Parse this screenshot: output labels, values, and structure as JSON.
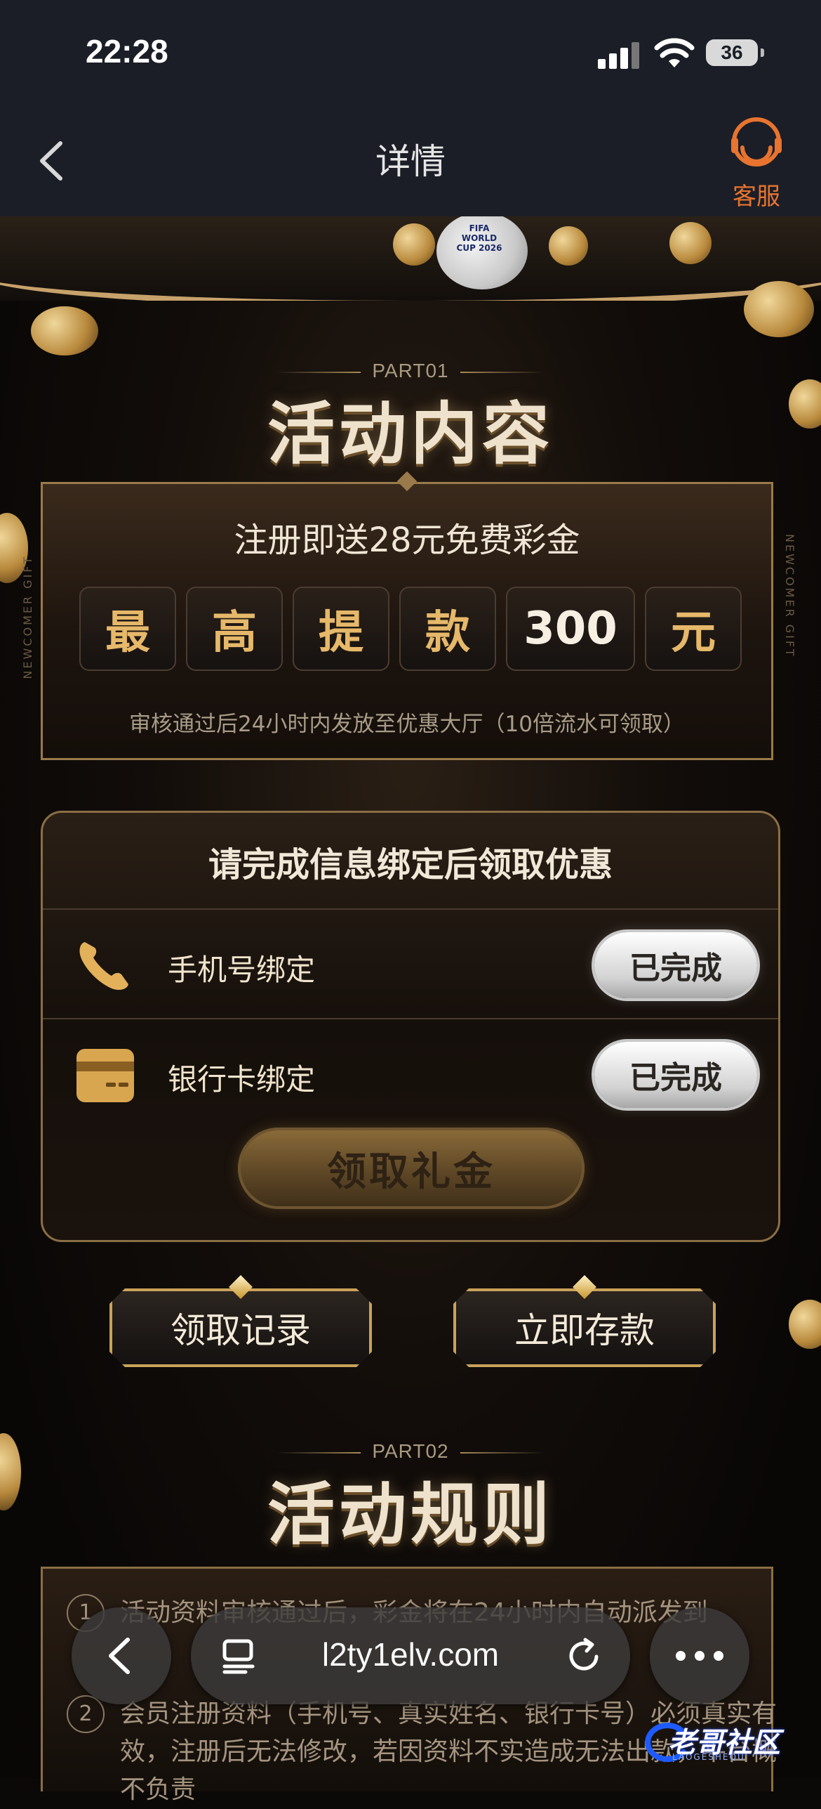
{
  "status": {
    "time": "22:28",
    "battery": "36"
  },
  "nav": {
    "title": "详情",
    "service_label": "客服"
  },
  "banner": {
    "ball_text": "FIFA WORLD CUP 2026"
  },
  "side_label": "NEWCOMER GIFT",
  "section1": {
    "part": "PART01",
    "heading": "活动内容",
    "title": "注册即送28元免费彩金",
    "digits": [
      "最",
      "高",
      "提",
      "款",
      "300",
      "元"
    ],
    "note": "审核通过后24小时内发放至优惠大厅（10倍流水可领取）"
  },
  "binding": {
    "title": "请完成信息绑定后领取优惠",
    "rows": [
      {
        "label": "手机号绑定",
        "status": "已完成",
        "icon": "phone-icon"
      },
      {
        "label": "银行卡绑定",
        "status": "已完成",
        "icon": "bank-card-icon"
      }
    ],
    "claim_button": "领取礼金"
  },
  "actions": {
    "records": "领取记录",
    "deposit": "立即存款"
  },
  "section2": {
    "part": "PART02",
    "heading": "活动规则",
    "rules": [
      {
        "num": "1",
        "text": "活动资料审核通过后，彩金将在24小时内自动派发到"
      },
      {
        "num": "2",
        "text": "会员注册资料（手机号、真实姓名、银行卡号）必须真实有效，注册后无法修改，若因资料不实造成无法出款，平台概不负责"
      }
    ]
  },
  "browser": {
    "url": "l2ty1elv.com"
  },
  "watermark": {
    "text": "老哥社区",
    "sub": "LAOGESHEQU"
  },
  "colors": {
    "accent": "#e8742f",
    "gold": "#c9a25a",
    "digit_gold": "#e6b86a"
  }
}
